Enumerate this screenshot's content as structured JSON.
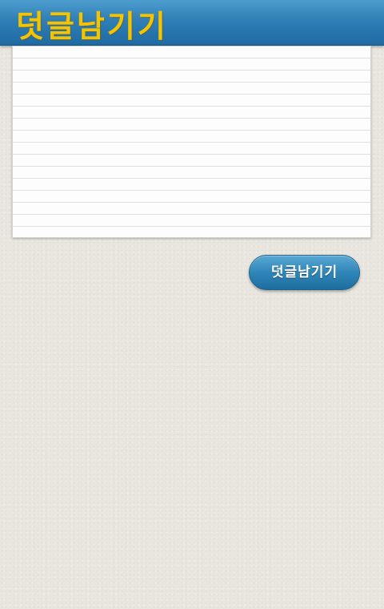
{
  "header": {
    "title": "덧글남기기"
  },
  "comment": {
    "value": "",
    "placeholder": ""
  },
  "actions": {
    "submit_label": "덧글남기기"
  },
  "colors": {
    "header_blue": "#2f7fb6",
    "title_yellow": "#f5c400",
    "button_blue": "#2f86b8",
    "background": "#e9e6df"
  }
}
